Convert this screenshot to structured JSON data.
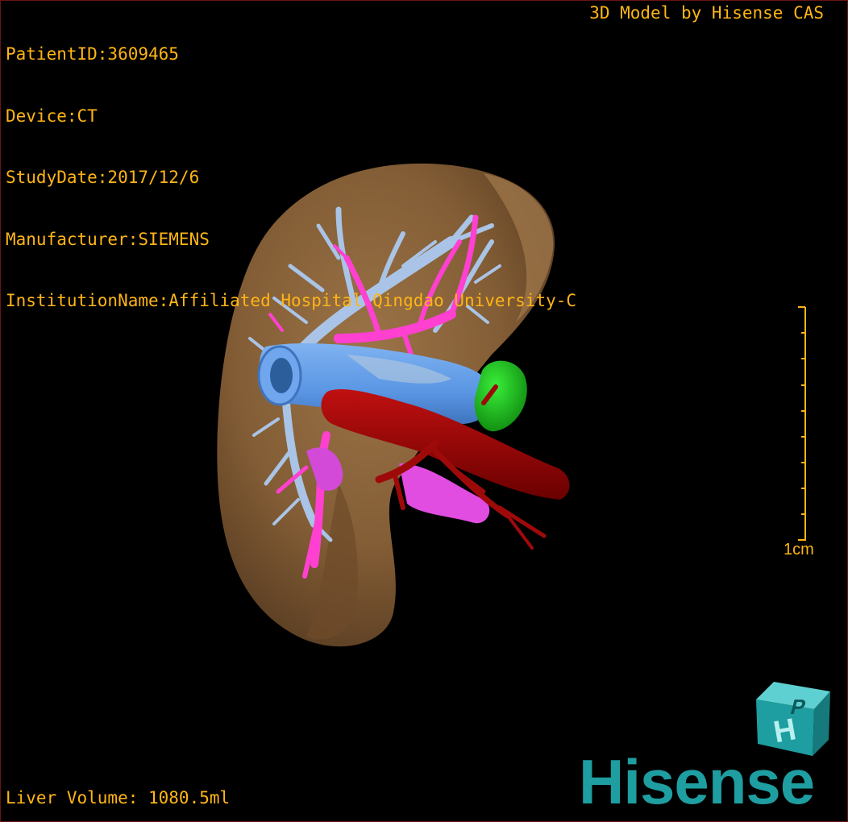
{
  "overlay": {
    "patient_id": "PatientID:3609465",
    "device": "Device:CT",
    "study_date": "StudyDate:2017/12/6",
    "manufacturer": "Manufacturer:SIEMENS",
    "institution": "InstitutionName:Affiliated Hospital Qingdao University-C",
    "credit": "3D Model by Hisense CAS",
    "liver_volume": "Liver Volume: 1080.5ml"
  },
  "scale_bar": {
    "label": "1cm"
  },
  "brand": {
    "name": "Hisense",
    "cube_icon": "hisense-cube-icon"
  },
  "colors": {
    "overlay_text": "#ffb515",
    "liver": "#8a6238",
    "hepatic_vein": "#a9c4e6",
    "vena_cava": "#5c9be8",
    "portal_vein": "#ff40d0",
    "artery": "#b00000",
    "tumor": "#1fcc1f",
    "brand": "#1e9ea0"
  },
  "model": {
    "structures": [
      "liver",
      "hepatic-vein",
      "inferior-vena-cava",
      "portal-vein",
      "hepatic-artery",
      "lesion"
    ]
  }
}
